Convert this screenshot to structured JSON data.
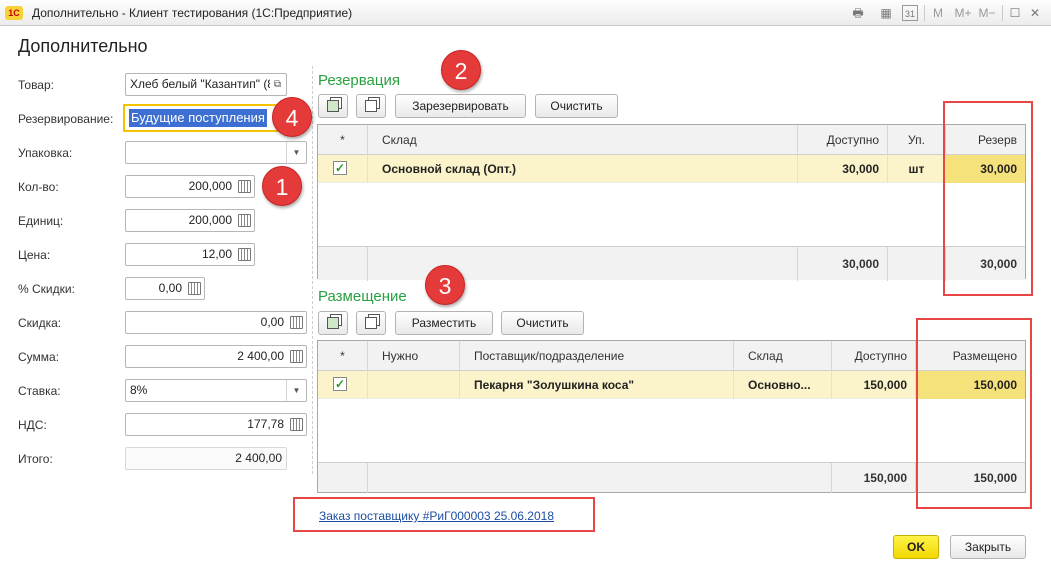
{
  "window": {
    "title": "Дополнительно - Клиент тестирования (1С:Предприятие)",
    "logo": "1С",
    "toolbar_icons": [
      "print-icon",
      "table-icon",
      "calendar-icon",
      "m-icon",
      "m-plus-icon",
      "m-minus-icon",
      "minimize-icon",
      "maximize-icon",
      "close-icon"
    ],
    "toolbar_labels": {
      "print": "🖶",
      "table": "▦",
      "calendar": "31",
      "m": "M",
      "m_plus": "M+",
      "m_minus": "M−",
      "minimize": "—",
      "maximize": "☐",
      "close": "✕"
    }
  },
  "form": {
    "title": "Дополнительно",
    "fields": {
      "tovar": {
        "label": "Товар:",
        "value": "Хлеб белый \"Казантип\" (8°"
      },
      "reserve_mode": {
        "label": "Резервирование:",
        "value": "Будущие поступления"
      },
      "package": {
        "label": "Упаковка:",
        "value": ""
      },
      "qty": {
        "label": "Кол-во:",
        "value": "200,000"
      },
      "units": {
        "label": "Единиц:",
        "value": "200,000"
      },
      "price": {
        "label": "Цена:",
        "value": "12,00"
      },
      "discount_pct": {
        "label": "% Скидки:",
        "value": "0,00"
      },
      "discount": {
        "label": "Скидка:",
        "value": "0,00"
      },
      "sum": {
        "label": "Сумма:",
        "value": "2 400,00"
      },
      "rate": {
        "label": "Ставка:",
        "value": "8%"
      },
      "vat": {
        "label": "НДС:",
        "value": "177,78"
      },
      "total": {
        "label": "Итого:",
        "value": "2 400,00"
      }
    }
  },
  "reservation": {
    "title": "Резервация",
    "buttons": {
      "reserve": "Зарезервировать",
      "clear": "Очистить"
    },
    "columns": {
      "mark": "*",
      "warehouse": "Склад",
      "available": "Доступно",
      "unit": "Уп.",
      "reserve": "Резерв"
    },
    "rows": [
      {
        "checked": "✓",
        "warehouse": "Основной склад (Опт.)",
        "available": "30,000",
        "unit": "шт",
        "reserve": "30,000"
      }
    ],
    "totals": {
      "available": "30,000",
      "reserve": "30,000"
    }
  },
  "placement": {
    "title": "Размещение",
    "buttons": {
      "place": "Разместить",
      "clear": "Очистить"
    },
    "columns": {
      "mark": "*",
      "needed": "Нужно",
      "supplier": "Поставщик/подразделение",
      "warehouse": "Склад",
      "available": "Доступно",
      "placed": "Размещено"
    },
    "rows": [
      {
        "checked": "✓",
        "needed": "",
        "supplier": "Пекарня \"Золушкина коса\"",
        "warehouse": "Основно...",
        "available": "150,000",
        "placed": "150,000"
      }
    ],
    "totals": {
      "available": "150,000",
      "placed": "150,000"
    }
  },
  "order_link": "Заказ поставщику #РиГ000003 25.06.2018",
  "footer_buttons": {
    "ok": "OK",
    "close": "Закрыть"
  },
  "annotations": {
    "badge1": "1",
    "badge2": "2",
    "badge3": "3",
    "badge4": "4"
  },
  "colors": {
    "section_title": "#2aa042",
    "highlight_row": "#fbf3c9",
    "annotation_red": "#e53a3a",
    "ok_button": "#f2d800",
    "link": "#1d4ea0"
  }
}
